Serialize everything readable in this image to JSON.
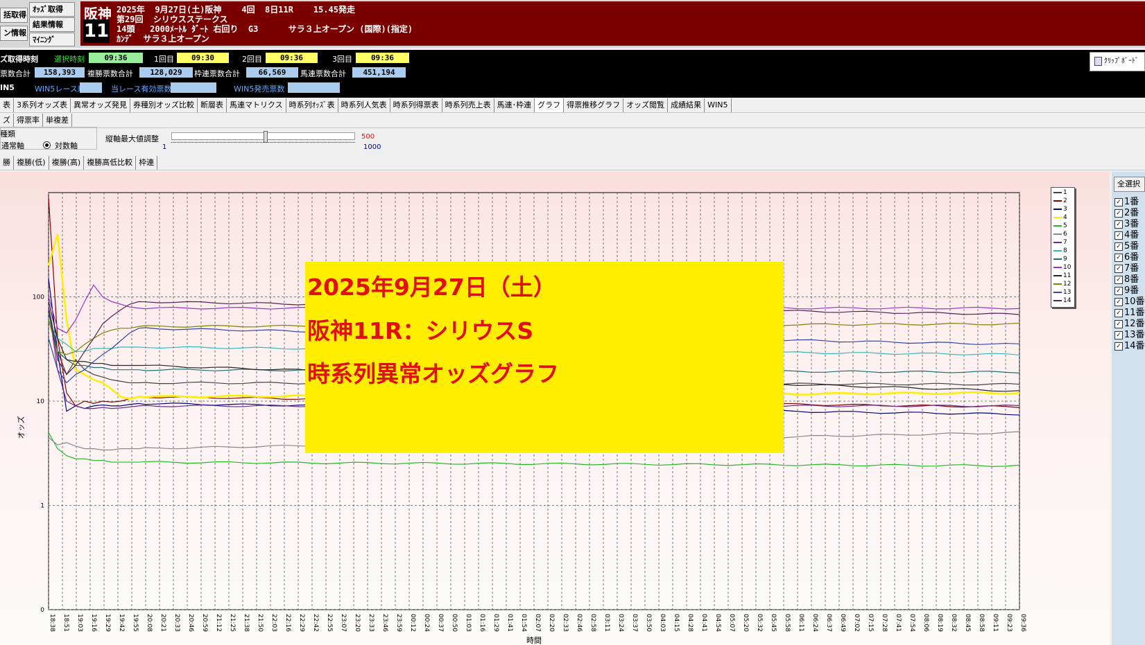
{
  "header": {
    "buttons": [
      "括取得",
      "ｵｯｽﾞ取得",
      "ン情報",
      "結果情報",
      "ﾏｲﾆﾝｸﾞ"
    ],
    "venue": "阪神",
    "race_no": "11",
    "line1": "2025年  9月27日(土)阪神    4回  8日11R    15.45発走",
    "line2": "第29回  シリウスステークス",
    "line3": "14頭   2000ﾒｰﾄﾙ ﾀﾞｰﾄ 右回り  G3      サラ３上オープン (国際)(指定)",
    "line4": "ｶﾝﾃﾞ  サラ３上オープン"
  },
  "info": {
    "fetch_time_label": "ズ取得時刻",
    "select_time_label": "選択時刻",
    "select_time": "09:36",
    "r1_label": "1回目",
    "r1_time": "09:30",
    "r2_label": "2回目",
    "r2_time": "09:36",
    "r3_label": "3回目",
    "r3_time": "09:36",
    "win_total_label": "票数合計",
    "win_total": "158,393",
    "place_total_label": "複勝票数合計",
    "place_total": "128,029",
    "bracket_total_label": "枠連票数合計",
    "bracket_total": "66,569",
    "quinella_total_label": "馬連票数合計",
    "quinella_total": "451,194",
    "win5_label": "IN5",
    "win5_order_label": "WIN5レース順",
    "valid_votes_label": "当レース有効票数",
    "win5_sales_label": "WIN5発売票数",
    "clipboard_label": "ｸﾘｯﾌﾟﾎﾞｰﾄﾞ"
  },
  "tabs_row1": [
    "表",
    "3系列オッズ表",
    "異常オッズ発見",
    "券種別オッズ比較",
    "断層表",
    "馬連マトリクス",
    "時系列ｵｯｽﾞ表",
    "時系列人気表",
    "時系列得票表",
    "時系列売上表",
    "馬連･枠連",
    "グラフ",
    "得票推移グラフ",
    "オッズ閲覧",
    "成績結果",
    "WIN5"
  ],
  "tabs_row1_active": "グラフ",
  "tabs_row2": [
    "ズ",
    "得票率",
    "単複差"
  ],
  "controls": {
    "axis_group": "種類",
    "normal_axis": "通常軸",
    "log_axis": "対数軸",
    "log_selected": true,
    "max_label": "縦軸最大値調整",
    "slider_min": "1",
    "slider_value": "500",
    "slider_max": "1000"
  },
  "tabs_row3": [
    "勝",
    "複勝(低)",
    "複勝(高)",
    "複勝高低比較",
    "枠連"
  ],
  "select_all_label": "全選択",
  "horses": [
    "1番",
    "2番",
    "3番",
    "4番",
    "5番",
    "6番",
    "7番",
    "8番",
    "9番",
    "10番",
    "11番",
    "12番",
    "13番",
    "14番"
  ],
  "overlay": {
    "line1": "2025年9月27日（土）",
    "line2": "阪神11R：シリウスS",
    "line3": "時系列異常オッズグラフ"
  },
  "chart_data": {
    "type": "line",
    "scale": "log",
    "ylabel": "オッズ",
    "xlabel": "時間",
    "ylim": [
      0,
      1000
    ],
    "yticks": [
      "100",
      "10",
      "1",
      "0"
    ],
    "x": [
      "18:38",
      "18:51",
      "19:03",
      "19:16",
      "19:29",
      "19:42",
      "19:55",
      "20:08",
      "20:21",
      "20:33",
      "20:46",
      "20:59",
      "21:12",
      "21:25",
      "21:38",
      "21:50",
      "22:03",
      "22:16",
      "22:29",
      "22:42",
      "22:55",
      "23:07",
      "23:20",
      "23:33",
      "23:46",
      "23:59",
      "00:12",
      "00:24",
      "00:37",
      "00:50",
      "01:03",
      "01:16",
      "01:29",
      "01:41",
      "01:54",
      "02:07",
      "02:20",
      "02:33",
      "02:46",
      "02:58",
      "03:11",
      "03:24",
      "03:37",
      "03:50",
      "04:03",
      "04:15",
      "04:28",
      "04:41",
      "04:54",
      "05:07",
      "05:20",
      "05:32",
      "05:45",
      "05:58",
      "06:11",
      "06:24",
      "06:37",
      "06:49",
      "07:02",
      "07:15",
      "07:28",
      "07:41",
      "07:54",
      "08:06",
      "08:19",
      "08:32",
      "08:45",
      "08:58",
      "09:11",
      "09:23",
      "09:36"
    ],
    "series": [
      {
        "name": "1",
        "color": "#444444",
        "start": [
          80,
          30,
          18,
          25,
          20,
          18,
          17,
          16,
          15.5,
          15,
          15
        ],
        "end": 14.5
      },
      {
        "name": "2",
        "color": "#8b0000",
        "start": [
          900,
          40,
          12,
          9,
          10,
          9.5,
          10,
          9.8,
          10,
          10.5,
          11
        ],
        "end": 8.8
      },
      {
        "name": "3",
        "color": "#000080",
        "start": [
          150,
          30,
          8,
          9,
          8.5,
          9,
          9.2,
          9,
          9,
          9.3,
          9.5
        ],
        "end": 7.5
      },
      {
        "name": "4",
        "color": "#ffee00",
        "start": [
          200,
          400,
          60,
          20,
          18,
          16,
          15,
          13,
          11,
          10.5,
          11
        ],
        "end": 12
      },
      {
        "name": "5",
        "color": "#22bb22",
        "start": [
          5,
          3.5,
          3,
          2.8,
          2.8,
          2.7,
          2.7,
          2.6,
          2.6,
          2.6,
          2.6
        ],
        "end": 2.4
      },
      {
        "name": "6",
        "color": "#888888",
        "start": [
          4.5,
          3.8,
          4,
          3.7,
          3.5,
          3.5,
          3.4,
          3.4,
          3.5,
          3.5,
          3.5
        ],
        "end": 5
      },
      {
        "name": "7",
        "color": "#6a2b8a",
        "start": [
          80,
          20,
          10,
          9,
          8.5,
          8.5,
          8.7,
          8.5,
          8.6,
          8.8,
          9
        ],
        "end": 9
      },
      {
        "name": "8",
        "color": "#33bbbb",
        "start": [
          60,
          40,
          35,
          30,
          30,
          32,
          32,
          32,
          33,
          33,
          33
        ],
        "end": 28
      },
      {
        "name": "9",
        "color": "#207070",
        "start": [
          70,
          30,
          25,
          22,
          22,
          21,
          21,
          20,
          20,
          20,
          20
        ],
        "end": 19
      },
      {
        "name": "10",
        "color": "#9933cc",
        "start": [
          100,
          50,
          45,
          60,
          90,
          130,
          100,
          90,
          85,
          80,
          78
        ],
        "end": 78
      },
      {
        "name": "11",
        "color": "#222222",
        "start": [
          90,
          40,
          25,
          24,
          24,
          23,
          23,
          22,
          22,
          22,
          22
        ],
        "end": 12.5
      },
      {
        "name": "12",
        "color": "#808000",
        "start": [
          60,
          30,
          28,
          30,
          35,
          40,
          45,
          48,
          50,
          50,
          52
        ],
        "end": 55
      },
      {
        "name": "13",
        "color": "#3344aa",
        "start": [
          40,
          20,
          15,
          18,
          20,
          24,
          28,
          32,
          38,
          45,
          50
        ],
        "end": 35
      },
      {
        "name": "14",
        "color": "#552255",
        "start": [
          80,
          25,
          18,
          22,
          30,
          40,
          55,
          65,
          75,
          85,
          90
        ],
        "end": 68
      }
    ]
  }
}
